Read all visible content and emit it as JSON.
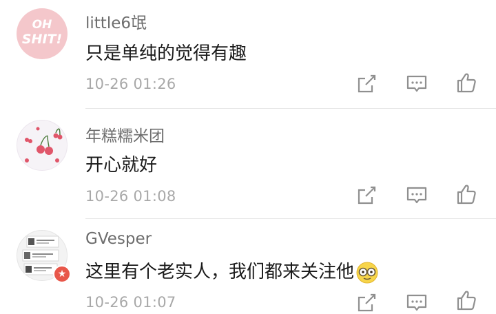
{
  "comments": [
    {
      "username": "little6氓",
      "content": "只是单纯的觉得有趣",
      "time": "10-26 01:26",
      "avatar_text": [
        "OH",
        "SHIT!"
      ]
    },
    {
      "username": "年糕糯米团",
      "content": "开心就好",
      "time": "10-26 01:08"
    },
    {
      "username": "GVesper",
      "content": "这里有个老实人，我们都来关注他",
      "time": "10-26 01:07",
      "avatar_badge": "★"
    }
  ],
  "actions": [
    "share-icon",
    "reply-icon",
    "like-icon"
  ],
  "colors": {
    "username": "#6d6d6d",
    "content": "#1a1a1a",
    "time": "#a8a8a8",
    "icon": "#8f8f8f",
    "divider": "#e6e6e6",
    "avatar1_bg": "#f4c7cb",
    "cherry": "#e0566a",
    "badge": "#e8574a"
  }
}
